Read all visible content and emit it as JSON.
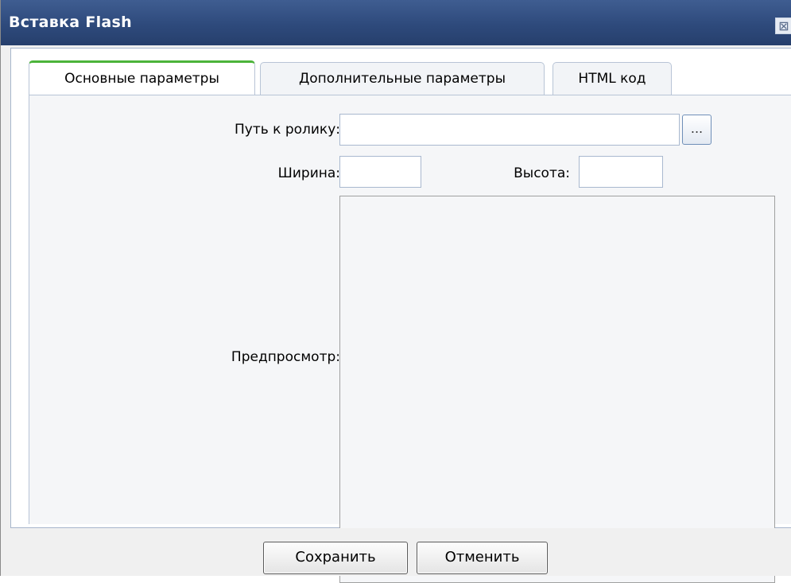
{
  "dialog": {
    "title": "Вставка Flash",
    "close_icon": "⊠"
  },
  "tabs": [
    {
      "label": "Основные параметры",
      "active": true
    },
    {
      "label": "Дополнительные параметры",
      "active": false
    },
    {
      "label": "HTML код",
      "active": false
    }
  ],
  "form": {
    "path_label": "Путь к ролику:",
    "path_value": "",
    "browse_label": "...",
    "width_label": "Ширина:",
    "width_value": "",
    "height_label": "Высота:",
    "height_value": "",
    "preview_label": "Предпросмотр:"
  },
  "buttons": {
    "save": "Сохранить",
    "cancel": "Отменить"
  },
  "colors": {
    "titlebar": "#2e4a7c",
    "active_tab_accent": "#4cb43a"
  }
}
